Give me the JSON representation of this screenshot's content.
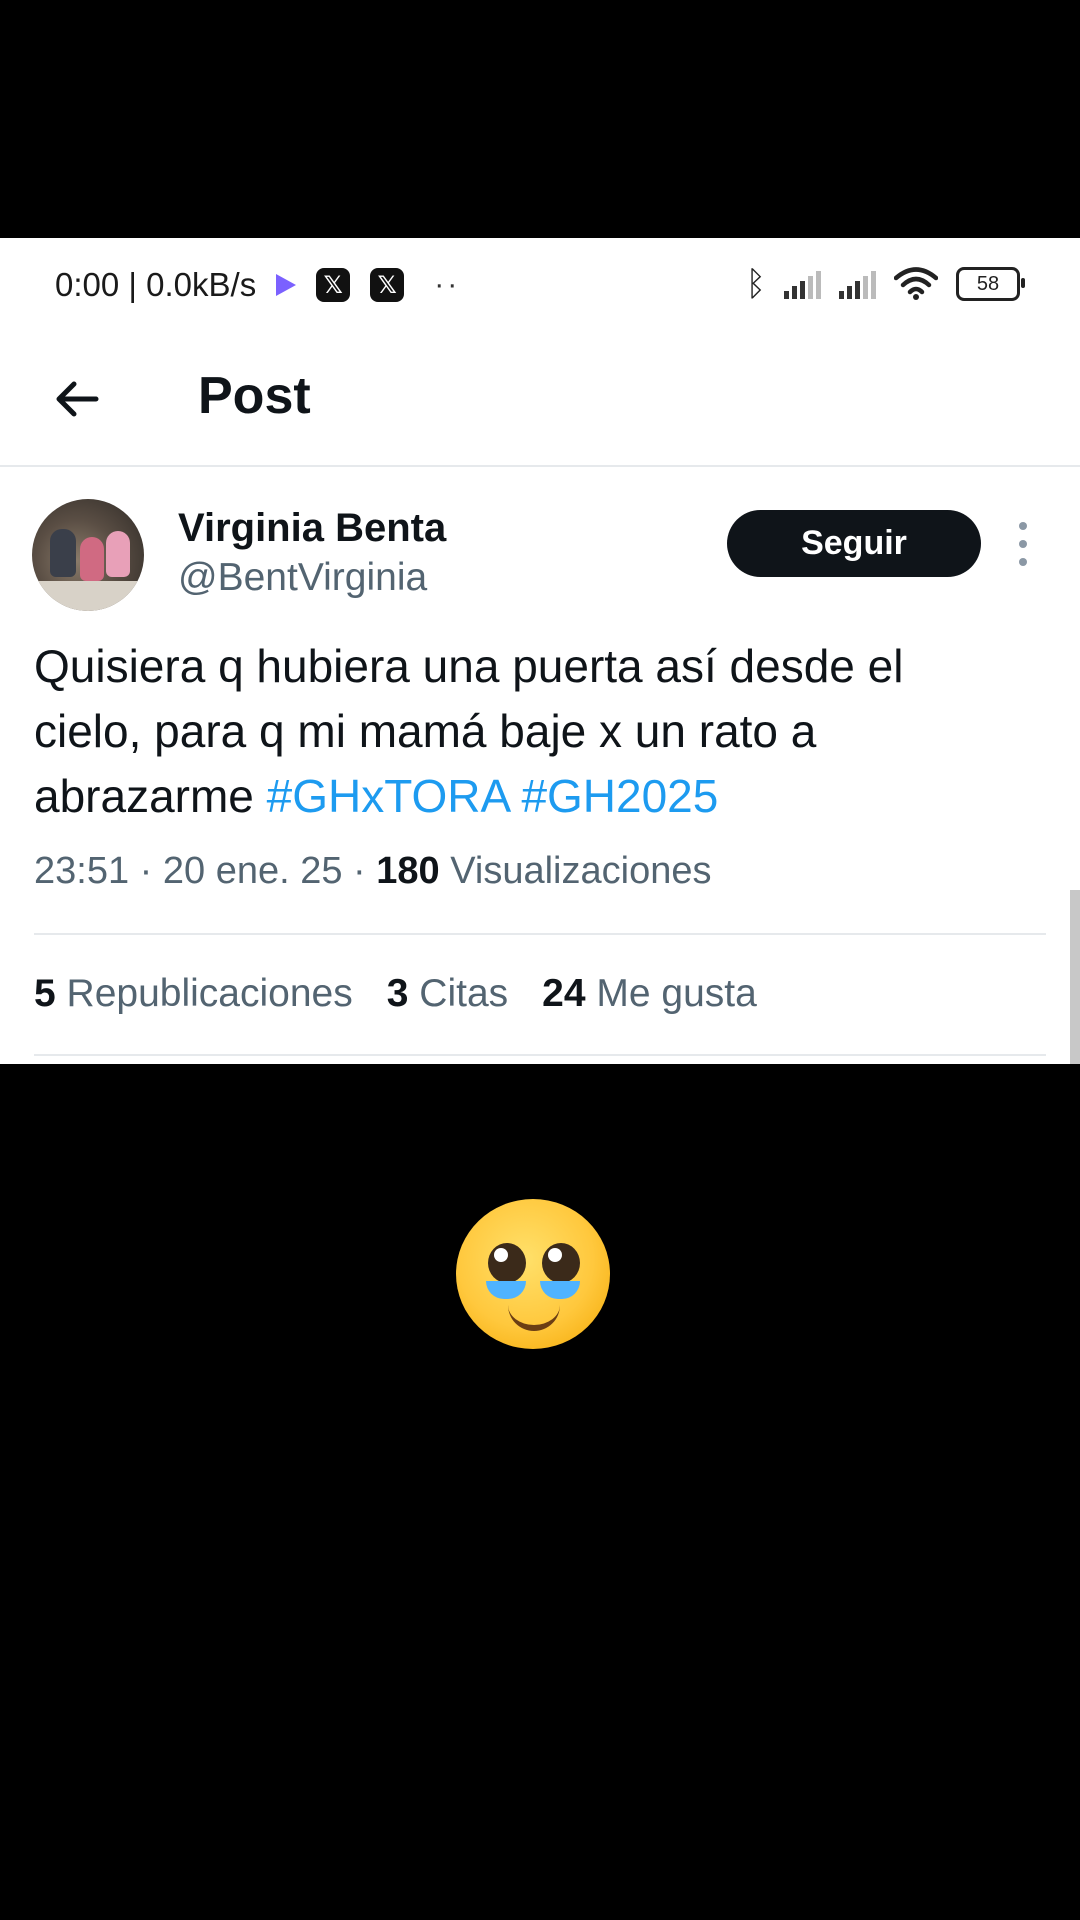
{
  "statusbar": {
    "time_speed": "0:00 | 0.0kB/s",
    "battery": "58",
    "icons": [
      "play-store-icon",
      "x-app-icon",
      "x-app-icon",
      "more-dots-icon",
      "bluetooth-icon",
      "signal-icon",
      "signal-icon",
      "wifi-icon",
      "battery-icon"
    ],
    "x_glyph": "𝕏",
    "dots": "··"
  },
  "header": {
    "title": "Post"
  },
  "tweet": {
    "author_name": "Virginia Benta",
    "author_handle": "@BentVirginia",
    "follow_label": "Seguir",
    "text": "Quisiera q hubiera una puerta así desde el cielo, para q mi mamá baje x un rato a abrazarme",
    "hashtags": [
      "#GHxTORA",
      "#GH2025"
    ],
    "time": "23:51",
    "date": "20 ene. 25",
    "views_count": "180",
    "views_label": "Visualizaciones",
    "sep": "·"
  },
  "stats": {
    "reposts_count": "5",
    "reposts_label": "Republicaciones",
    "quotes_count": "3",
    "quotes_label": "Citas",
    "likes_count": "24",
    "likes_label": "Me gusta"
  },
  "media": {
    "emoji_name": "pleading-face-with-tears-icon"
  },
  "colors": {
    "accent": "#1d9bf0",
    "text_primary": "#0f1419",
    "text_secondary": "#536471",
    "button_bg": "#0f1419"
  }
}
